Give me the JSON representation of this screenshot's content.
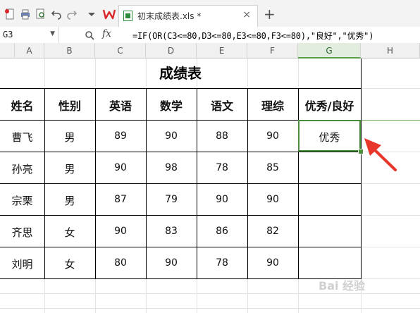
{
  "toolbar": {
    "icons": [
      "new-doc-icon",
      "print-icon",
      "print-preview-icon",
      "undo-icon",
      "redo-icon",
      "more-dropdown-icon",
      "wps-logo-icon"
    ],
    "tab_title": "初末成绩表.xls *",
    "close_label": "×",
    "new_tab_label": "+"
  },
  "formula_bar": {
    "cell_ref": "G3",
    "fx_label": "fx",
    "formula": "=IF(OR(C3<=80,D3<=80,E3<=80,F3<=80),\"良好\",\"优秀\")"
  },
  "columns": [
    "A",
    "B",
    "C",
    "D",
    "E",
    "F",
    "G",
    "H"
  ],
  "active_column": "G",
  "sheet": {
    "title": "成绩表",
    "headers": [
      "姓名",
      "性别",
      "英语",
      "数学",
      "语文",
      "理综",
      "优秀/良好"
    ],
    "rows": [
      [
        "曹飞",
        "男",
        "89",
        "90",
        "88",
        "90",
        "优秀"
      ],
      [
        "孙亮",
        "男",
        "90",
        "98",
        "78",
        "85",
        ""
      ],
      [
        "宗栗",
        "男",
        "87",
        "79",
        "90",
        "90",
        ""
      ],
      [
        "齐思",
        "女",
        "90",
        "83",
        "86",
        "82",
        ""
      ],
      [
        "刘明",
        "女",
        "80",
        "90",
        "78",
        "90",
        ""
      ]
    ]
  },
  "colors": {
    "selection": "#4a8f3c",
    "arrow": "#e8362a",
    "accent_red": "#d9262b"
  },
  "watermark": "Bai 经验"
}
